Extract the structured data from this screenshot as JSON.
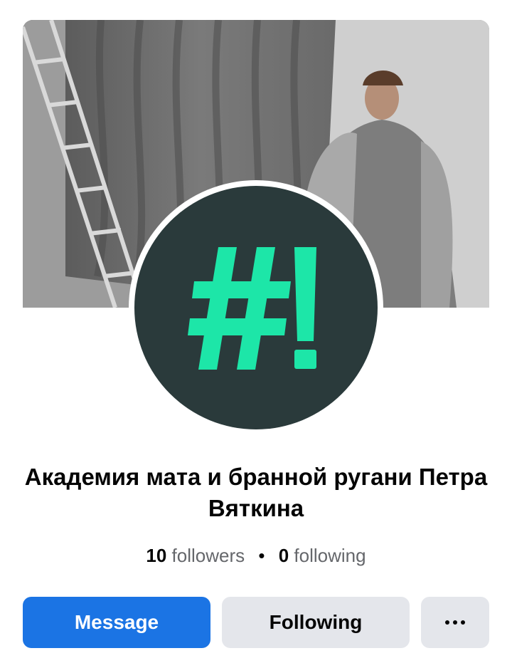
{
  "page": {
    "name": "Академия мата и бранной ругани Петра Вяткина",
    "followers_count": "10",
    "followers_label": "followers",
    "separator": "•",
    "following_count": "0",
    "following_label": "following"
  },
  "avatar": {
    "text": "#!",
    "background": "#2a3a3b",
    "foreground": "#1de6a8"
  },
  "actions": {
    "message_label": "Message",
    "following_label": "Following",
    "more_icon": "more-horizontal-icon"
  },
  "colors": {
    "primary": "#1b74e4",
    "secondary_button": "#e4e6eb"
  }
}
